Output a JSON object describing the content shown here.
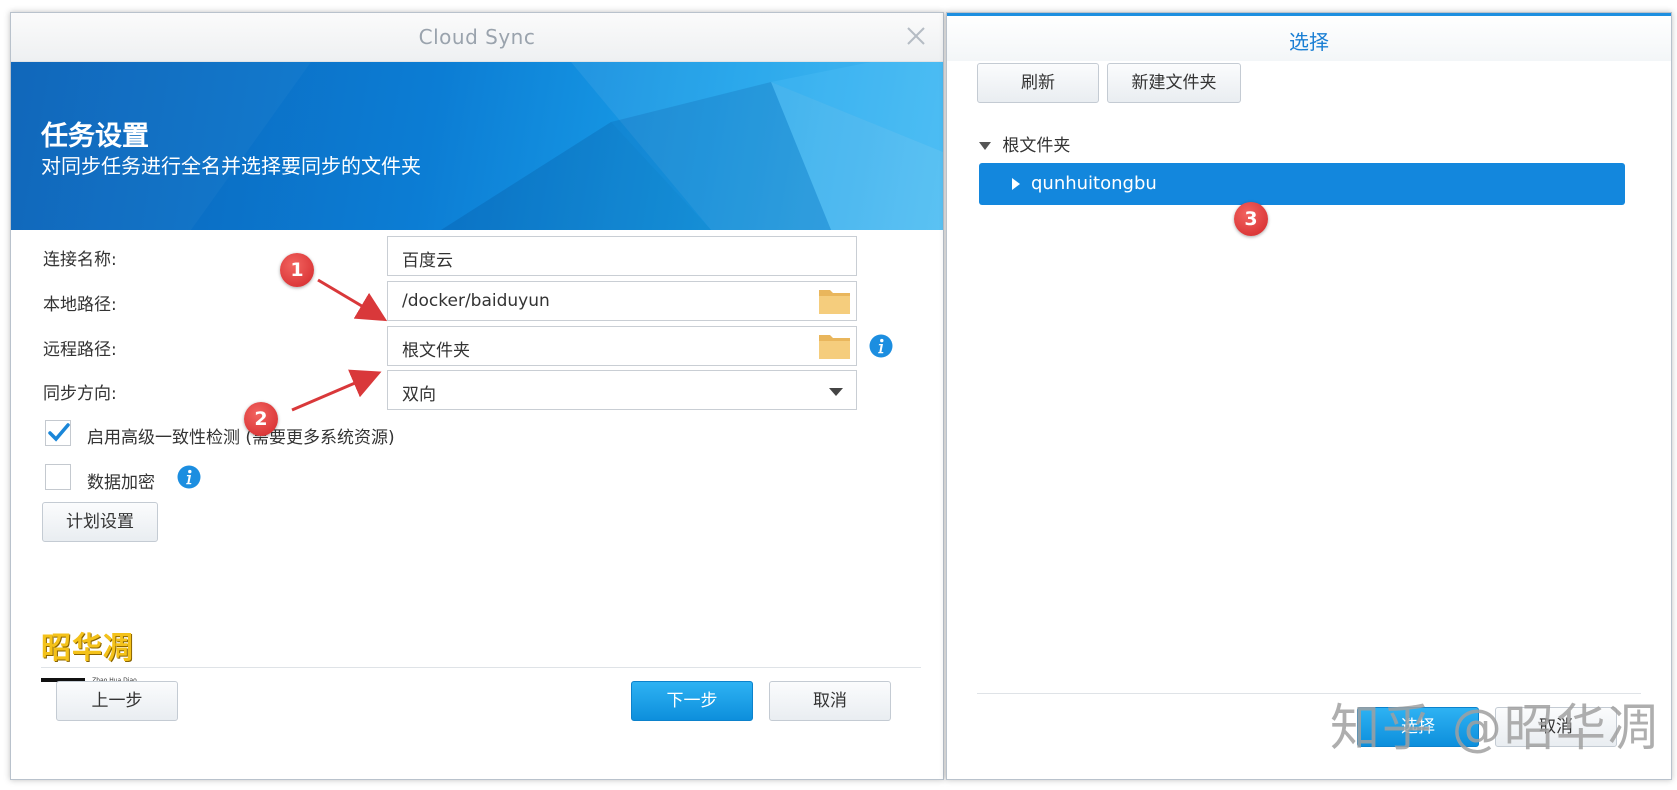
{
  "left_dialog": {
    "title": "Cloud Sync",
    "banner_title": "任务设置",
    "banner_subtitle": "对同步任务进行全名并选择要同步的文件夹",
    "fields": {
      "connection_name_label": "连接名称:",
      "connection_name_value": "百度云",
      "local_path_label": "本地路径:",
      "local_path_value": "/docker/baiduyun",
      "remote_path_label": "远程路径:",
      "remote_path_value": "根文件夹",
      "sync_direction_label": "同步方向:",
      "sync_direction_value": "双向"
    },
    "checkboxes": {
      "consistency_label": "启用高级一致性检测 (需要更多系统资源)",
      "consistency_checked": true,
      "encryption_label": "数据加密",
      "encryption_checked": false
    },
    "schedule_button": "计划设置",
    "logo_text": "昭华凋",
    "logo_subtext": "Zhao Hua Diao",
    "footer": {
      "back_button": "上一步",
      "next_button": "下一步",
      "cancel_button": "取消"
    }
  },
  "right_dialog": {
    "title": "选择",
    "refresh_button": "刷新",
    "new_folder_button": "新建文件夹",
    "tree_root_label": "根文件夹",
    "tree_selected_label": "qunhuitongbu",
    "footer": {
      "select_button": "选择",
      "cancel_button": "取消"
    }
  },
  "annotations": {
    "badge_1": "1",
    "badge_2": "2",
    "badge_3": "3"
  },
  "watermark": "知乎 @昭华凋",
  "colors": {
    "accent_blue": "#1387dd",
    "badge_red": "#d3272a",
    "folder_yellow": "#f2c46c"
  }
}
